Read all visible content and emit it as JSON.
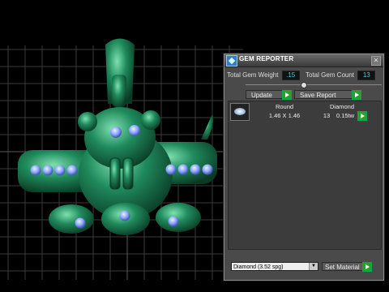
{
  "panel": {
    "title": "GEM REPORTER",
    "close_glyph": "✕",
    "total_gem_weight_label": "Total Gem Weight",
    "total_gem_weight_value": ".15",
    "total_gem_count_label": "Total Gem Count",
    "total_gem_count_value": "13",
    "update_label": "Update",
    "save_report_label": "Save Report"
  },
  "gem_table": {
    "headers": [
      "Round",
      "Diamond"
    ],
    "row": {
      "size": "1.46 X 1.46",
      "count": "13",
      "weight": "0.15tw"
    }
  },
  "material": {
    "selected": "Diamond    (3.52 spg)",
    "set_material_label": "Set Material"
  },
  "colors": {
    "model_green": "#1f8a5c",
    "gem_blue": "#8aa6ff",
    "value_cyan": "#4ec8e8",
    "go_green": "#2aa02a"
  }
}
